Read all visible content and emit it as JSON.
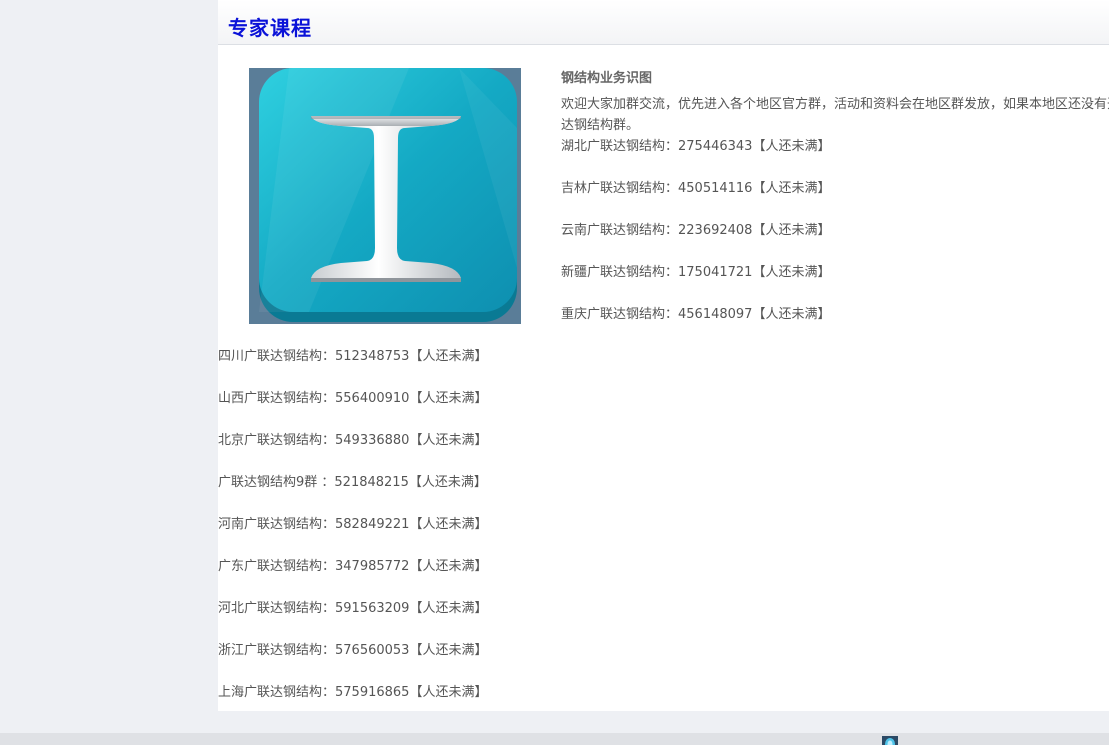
{
  "section": {
    "title": "专家课程"
  },
  "course": {
    "image_icon": "steel-i-beam-app-icon",
    "title": "钢结构业务识图",
    "intro_line1": "欢迎大家加群交流，优先进入各个地区官方群，活动和资料会在地区群发放，如果本地区还没有开通，可进入广联",
    "intro_line2": "达钢结构群。"
  },
  "groups_right": [
    {
      "name": "湖北广联达钢结构：275446343【人还未满】"
    },
    {
      "name": "吉林广联达钢结构：450514116【人还未满】"
    },
    {
      "name": "云南广联达钢结构：223692408【人还未满】"
    },
    {
      "name": "新疆广联达钢结构：175041721【人还未满】"
    },
    {
      "name": "重庆广联达钢结构：456148097【人还未满】"
    }
  ],
  "groups_left": [
    {
      "name": "四川广联达钢结构：512348753【人还未满】"
    },
    {
      "name": "山西广联达钢结构：556400910【人还未满】"
    },
    {
      "name": "北京广联达钢结构：549336880【人还未满】"
    },
    {
      "name": "广联达钢结构9群 ：521848215【人还未满】"
    },
    {
      "name": "河南广联达钢结构：582849221【人还未满】"
    },
    {
      "name": "广东广联达钢结构：347985772【人还未满】"
    },
    {
      "name": "河北广联达钢结构：591563209【人还未满】"
    },
    {
      "name": "浙江广联达钢结构：576560053【人还未满】"
    },
    {
      "name": "上海广联达钢结构：575916865【人还未满】"
    }
  ],
  "colors": {
    "title_blue": "#0a12d8",
    "icon_teal": "#1aaec6",
    "page_bg": "#eef0f4"
  },
  "tray": {
    "icon": "shield-tray-icon"
  }
}
